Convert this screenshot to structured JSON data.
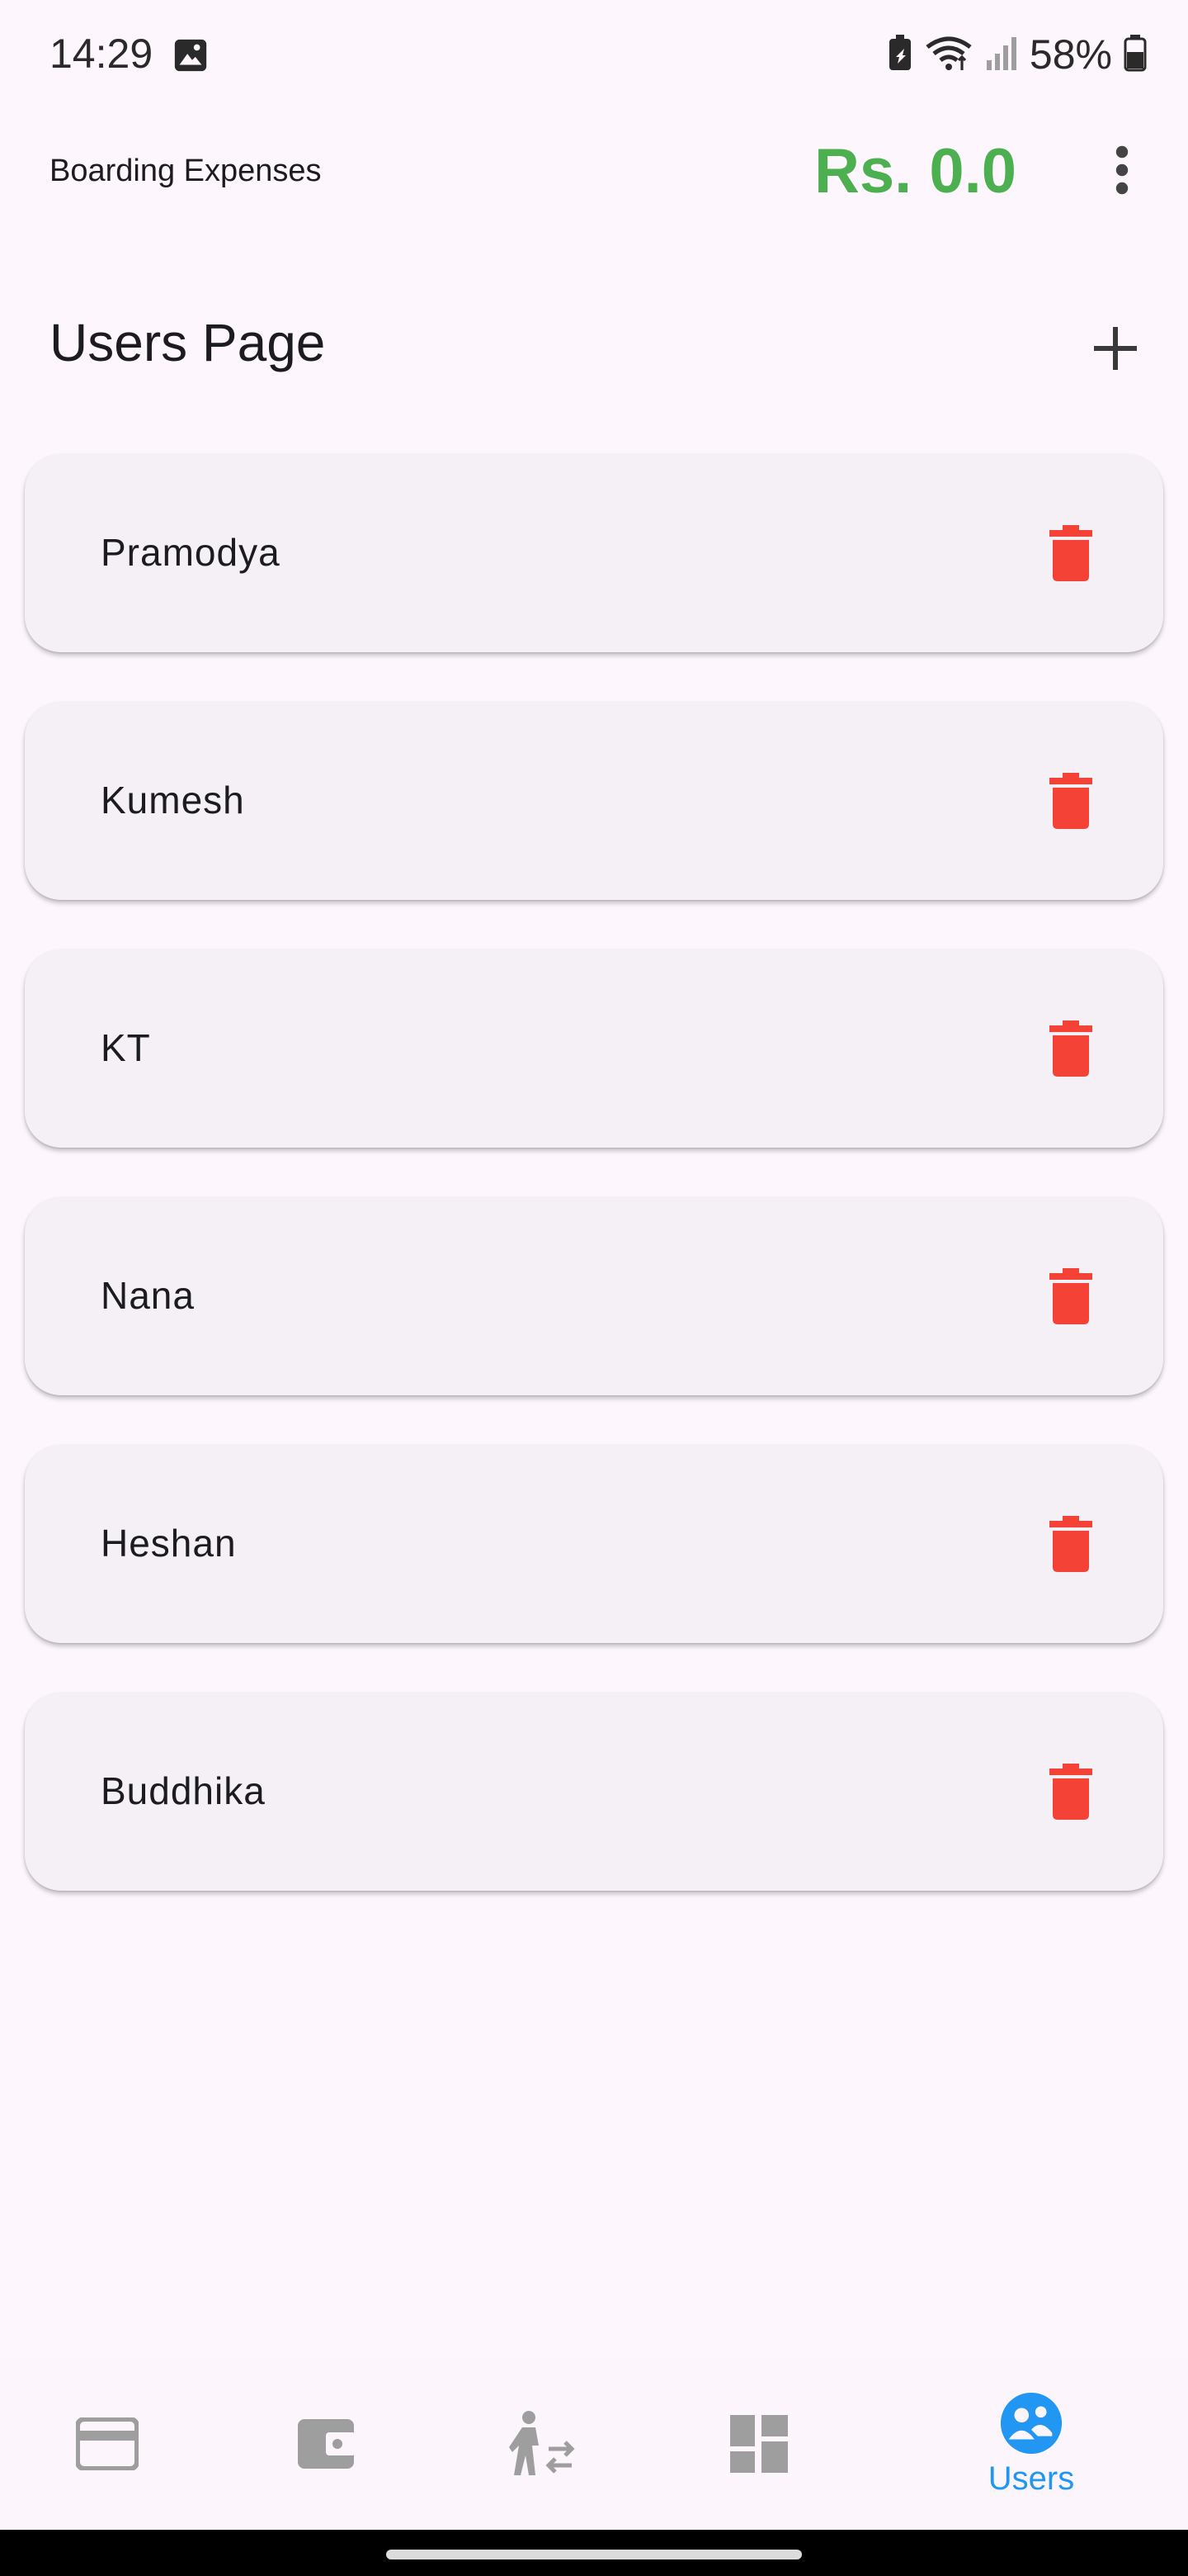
{
  "status_bar": {
    "time": "14:29",
    "battery": "58%"
  },
  "app_bar": {
    "title": "Boarding Expenses",
    "total": "Rs. 0.0"
  },
  "page": {
    "title": "Users Page"
  },
  "users": [
    {
      "name": "Pramodya"
    },
    {
      "name": "Kumesh"
    },
    {
      "name": "KT"
    },
    {
      "name": "Nana"
    },
    {
      "name": "Heshan"
    },
    {
      "name": "Buddhika"
    }
  ],
  "bottom_nav": {
    "items": [
      {
        "icon": "credit-card-icon",
        "label": ""
      },
      {
        "icon": "wallet-icon",
        "label": ""
      },
      {
        "icon": "person-transfer-icon",
        "label": ""
      },
      {
        "icon": "dashboard-icon",
        "label": ""
      },
      {
        "icon": "users-icon",
        "label": "Users",
        "active": true
      }
    ]
  },
  "colors": {
    "accent_green": "#4caf50",
    "delete_red": "#f44336",
    "active_blue": "#2196f3",
    "inactive_grey": "#9e9e9e"
  }
}
